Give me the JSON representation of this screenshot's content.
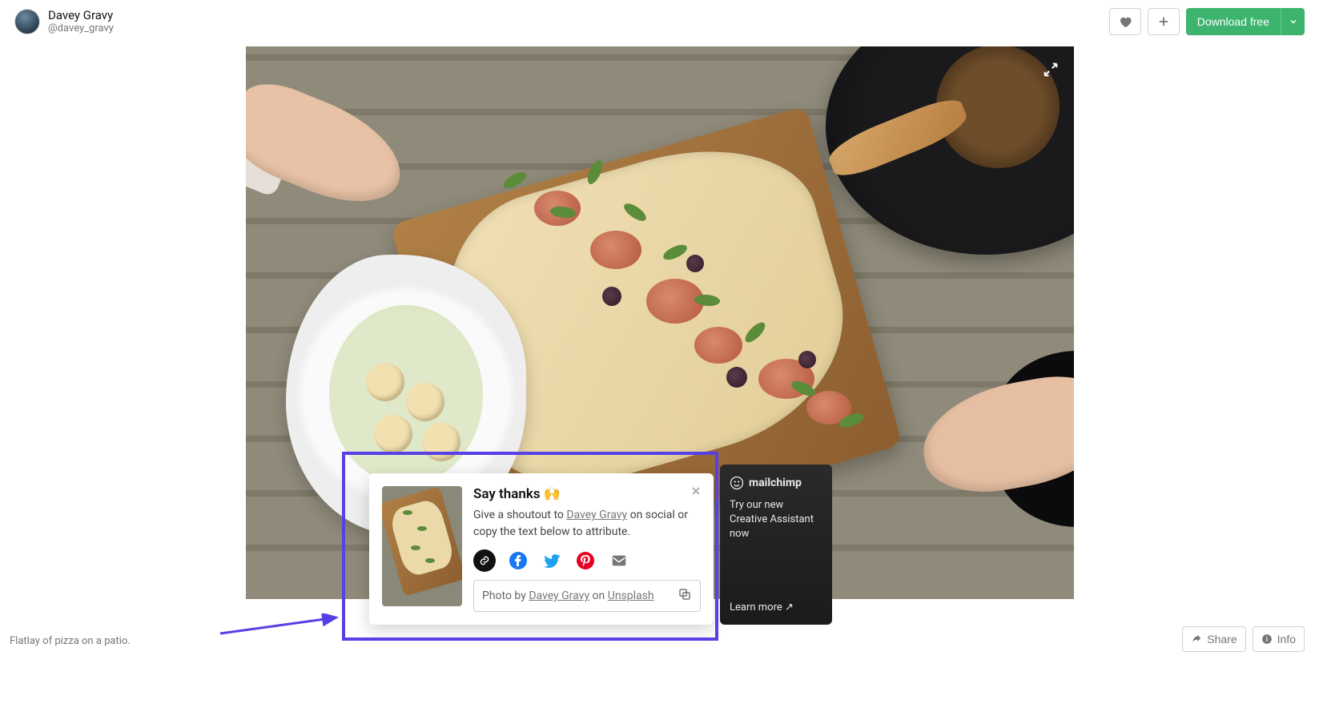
{
  "header": {
    "author_name": "Davey Gravy",
    "author_handle": "@davey_gravy",
    "download_label": "Download free"
  },
  "caption": "Flatlay of pizza on a patio.",
  "thanks": {
    "title": "Say thanks 🙌",
    "desc_prefix": "Give a shoutout to ",
    "desc_author": "Davey Gravy",
    "desc_suffix": " on social or copy the text below to attribute.",
    "attrib_prefix": "Photo by ",
    "attrib_author": "Davey Gravy",
    "attrib_middle": " on ",
    "attrib_site": "Unsplash"
  },
  "promo": {
    "brand": "mailchimp",
    "text": "Try our new Creative Assistant now",
    "cta": "Learn more ↗"
  },
  "bottom": {
    "share_label": "Share",
    "info_label": "Info"
  }
}
